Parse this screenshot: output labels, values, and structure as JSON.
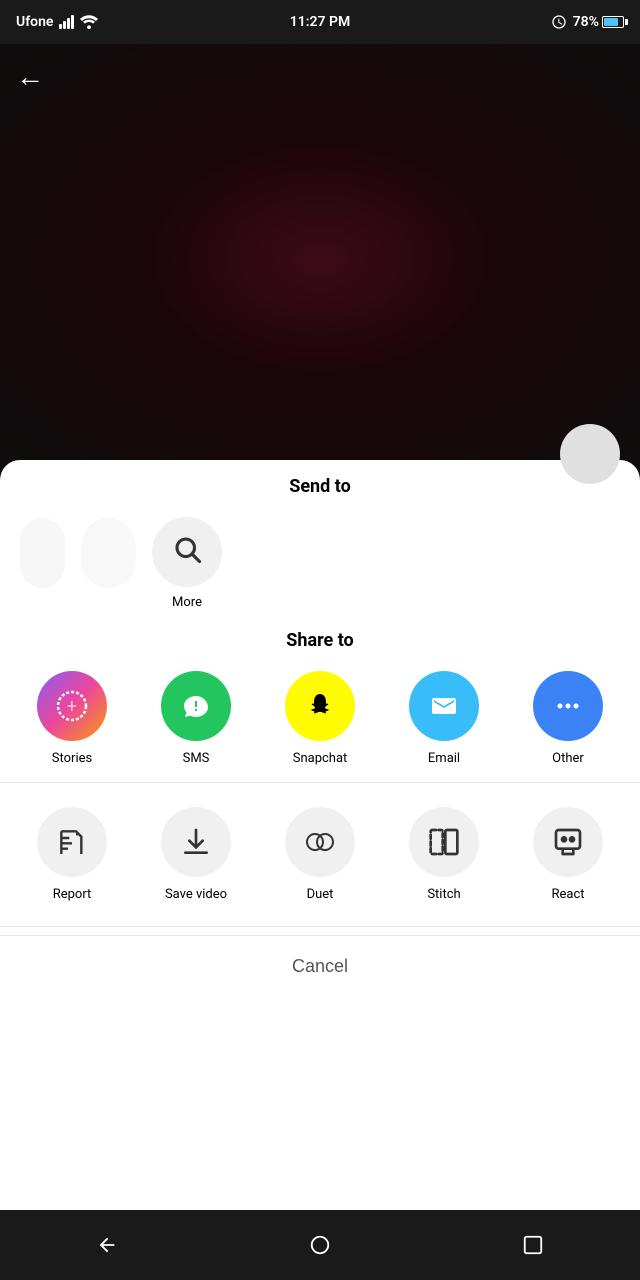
{
  "statusBar": {
    "carrier": "Ufone",
    "time": "11:27 PM",
    "battery": "78%",
    "alarm": true
  },
  "header": {
    "backLabel": "←"
  },
  "sheet": {
    "sendToTitle": "Send to",
    "shareToTitle": "Share to",
    "moreLabel": "More",
    "contacts": [],
    "shareItems": [
      {
        "id": "stories",
        "label": "Stories",
        "color": "gradient"
      },
      {
        "id": "sms",
        "label": "SMS",
        "color": "#22c55e"
      },
      {
        "id": "snapchat",
        "label": "Snapchat",
        "color": "#FFFC00"
      },
      {
        "id": "email",
        "label": "Email",
        "color": "#38bdf8"
      },
      {
        "id": "other",
        "label": "Other",
        "color": "#3b82f6"
      }
    ],
    "actionItems": [
      {
        "id": "report",
        "label": "Report"
      },
      {
        "id": "save-video",
        "label": "Save video"
      },
      {
        "id": "duet",
        "label": "Duet"
      },
      {
        "id": "stitch",
        "label": "Stitch"
      },
      {
        "id": "react",
        "label": "React"
      }
    ],
    "cancelLabel": "Cancel"
  },
  "navbar": {
    "back": "◁",
    "home": "○",
    "recent": "□"
  }
}
